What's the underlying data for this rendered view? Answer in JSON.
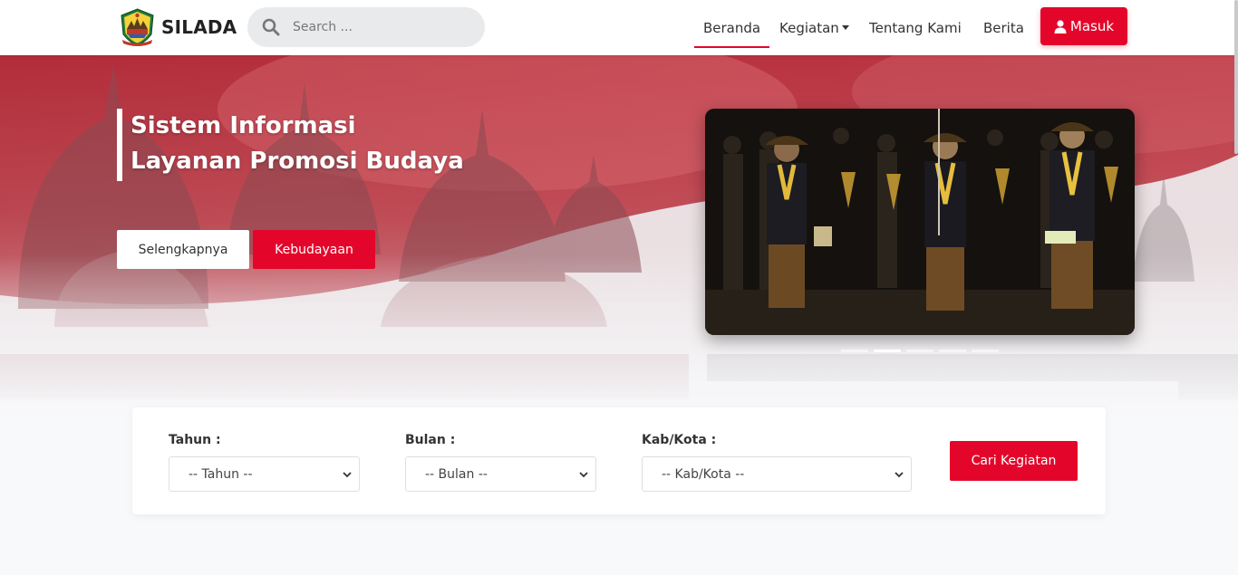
{
  "navbar": {
    "brand": "SILADA",
    "search_placeholder": "Search ...",
    "items": [
      {
        "label": "Beranda",
        "active": true
      },
      {
        "label": "Kegiatan",
        "dropdown": true
      },
      {
        "label": "Tentang Kami"
      },
      {
        "label": "Berita"
      }
    ],
    "login_label": "Masuk"
  },
  "hero": {
    "title_line1": "Sistem Informasi",
    "title_line2": "Layanan Promosi Budaya",
    "primary_button": "Selengkapnya",
    "secondary_button": "Kebudayaan",
    "carousel": {
      "slide_count": 5,
      "active_index": 1
    }
  },
  "filter": {
    "tahun_label": "Tahun :",
    "tahun_value": "-- Tahun --",
    "bulan_label": "Bulan :",
    "bulan_value": "-- Bulan --",
    "kabkota_label": "Kab/Kota :",
    "kabkota_value": "-- Kab/Kota --",
    "submit_label": "Cari Kegiatan"
  },
  "colors": {
    "accent": "#e4062a",
    "hero_red": "#c0303f",
    "search_bg": "#e9eaec"
  }
}
